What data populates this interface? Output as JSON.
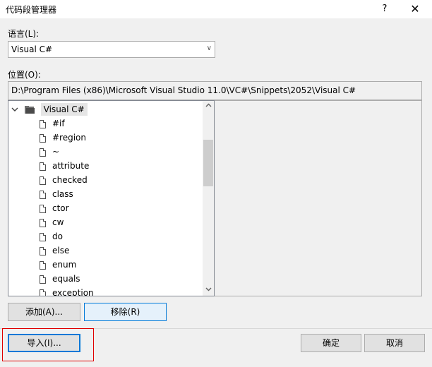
{
  "window": {
    "title": "代码段管理器",
    "help_label": "?",
    "close_label": "✕"
  },
  "language": {
    "label": "语言(L):",
    "value": "Visual C#",
    "arrow": "∨"
  },
  "location": {
    "label": "位置(O):",
    "path": "D:\\Program Files (x86)\\Microsoft Visual Studio 11.0\\VC#\\Snippets\\2052\\Visual C#"
  },
  "tree": {
    "root": "Visual C#",
    "items": [
      "#if",
      "#region",
      "~",
      "attribute",
      "checked",
      "class",
      "ctor",
      "cw",
      "do",
      "else",
      "enum",
      "equals",
      "exception"
    ]
  },
  "buttons": {
    "add": "添加(A)...",
    "remove": "移除(R)",
    "import": "导入(I)...",
    "ok": "确定",
    "cancel": "取消"
  },
  "icons": {
    "expand": "chevron-down-icon",
    "folder": "folder-icon",
    "snippet": "document-icon"
  },
  "colors": {
    "accent": "#0078d7",
    "highlight": "#e00000"
  }
}
